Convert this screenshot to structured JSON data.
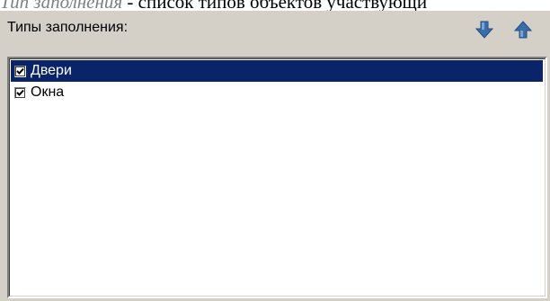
{
  "document": {
    "term": "Тип заполнения",
    "text": " - список типов объектов участвующи"
  },
  "panel": {
    "title": "Типы заполнения:",
    "move_down_icon": "arrow-down-icon",
    "move_up_icon": "arrow-up-icon",
    "accent_color": "#3a6ea5"
  },
  "list": {
    "selected_index": 0,
    "selection_color": "#0a246a",
    "items": [
      {
        "label": "Двери",
        "checked": true
      },
      {
        "label": "Окна",
        "checked": true
      }
    ]
  }
}
